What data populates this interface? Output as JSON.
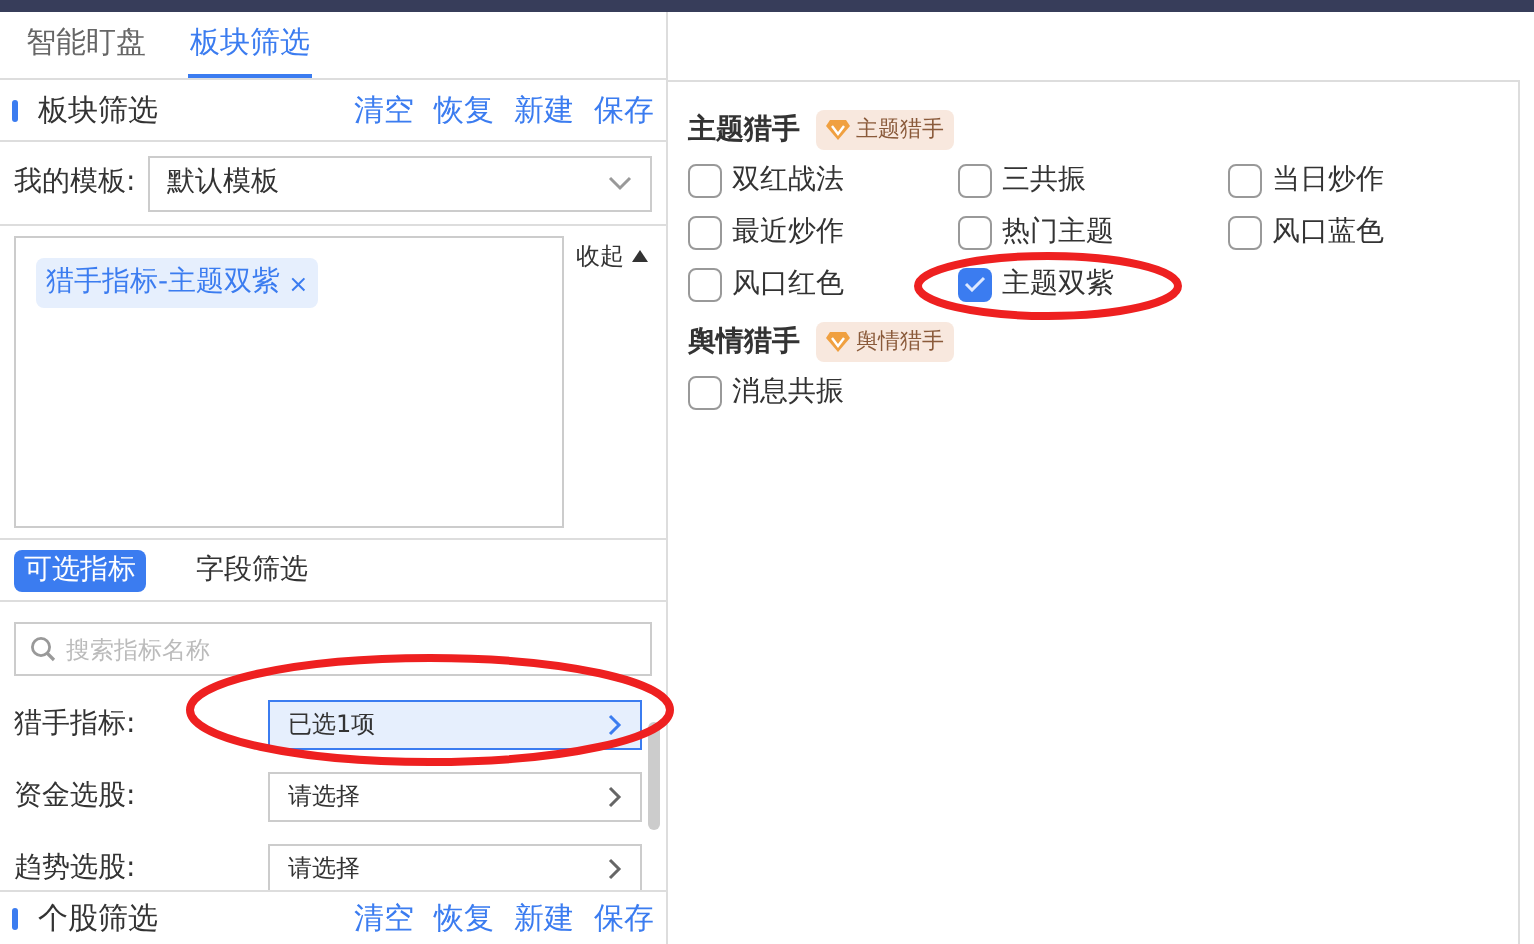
{
  "top_tabs": [
    {
      "label": "智能盯盘",
      "selected": false
    },
    {
      "label": "板块筛选",
      "selected": true
    }
  ],
  "section": {
    "title": "板块筛选",
    "actions": [
      "清空",
      "恢复",
      "新建",
      "保存"
    ]
  },
  "template": {
    "label": "我的模板:",
    "value": "默认模板"
  },
  "tags": [
    {
      "label": "猎手指标-主题双紫",
      "remove": "×"
    }
  ],
  "collapse": {
    "label": "收起"
  },
  "sub_tabs": [
    {
      "label": "可选指标",
      "selected": true
    },
    {
      "label": "字段筛选",
      "selected": false
    }
  ],
  "search": {
    "placeholder": "搜索指标名称"
  },
  "fields": [
    {
      "label": "猎手指标:",
      "value": "已选1项",
      "active": true
    },
    {
      "label": "资金选股:",
      "value": "请选择",
      "active": false
    },
    {
      "label": "趋势选股:",
      "value": "请选择",
      "active": false
    }
  ],
  "footer": {
    "title": "个股筛选",
    "actions": [
      "清空",
      "恢复",
      "新建",
      "保存"
    ]
  },
  "groups": [
    {
      "title": "主题猎手",
      "badge": "主题猎手",
      "options": [
        {
          "label": "双红战法",
          "checked": false
        },
        {
          "label": "三共振",
          "checked": false
        },
        {
          "label": "当日炒作",
          "checked": false
        },
        {
          "label": "最近炒作",
          "checked": false
        },
        {
          "label": "热门主题",
          "checked": false
        },
        {
          "label": "风口蓝色",
          "checked": false
        },
        {
          "label": "风口红色",
          "checked": false
        },
        {
          "label": "主题双紫",
          "checked": true
        }
      ]
    },
    {
      "title": "舆情猎手",
      "badge": "舆情猎手",
      "options": [
        {
          "label": "消息共振",
          "checked": false
        }
      ]
    }
  ]
}
